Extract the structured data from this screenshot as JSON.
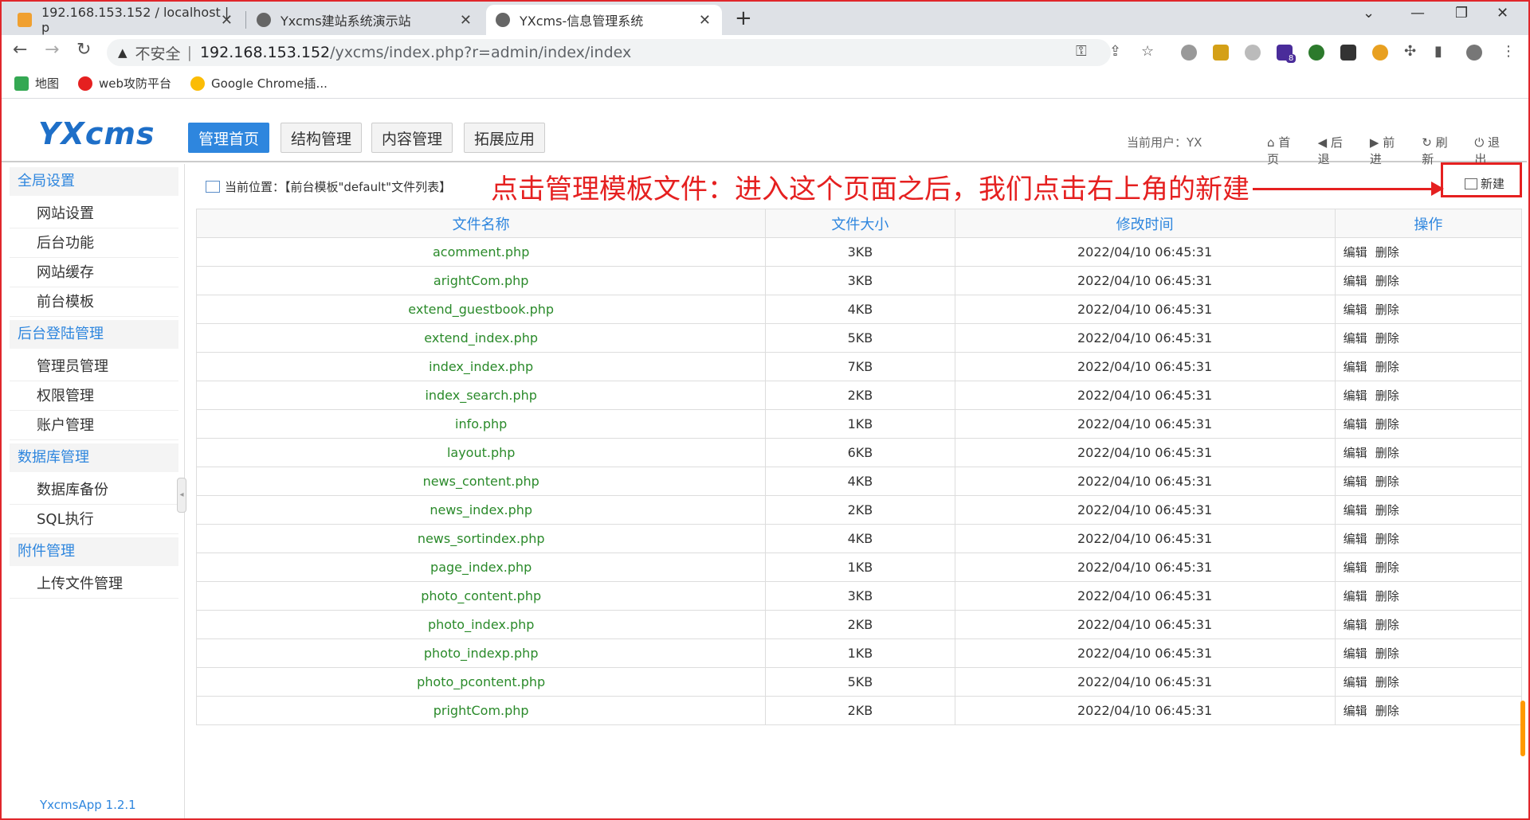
{
  "browser": {
    "tabs": [
      {
        "title": "192.168.153.152 / localhost | p",
        "active": false
      },
      {
        "title": "Yxcms建站系统演示站",
        "active": false
      },
      {
        "title": "YXcms-信息管理系统",
        "active": true
      }
    ],
    "address": {
      "security": "不安全",
      "host": "192.168.153.152",
      "path": "/yxcms/index.php?r=admin/index/index"
    },
    "extension_badge": "8",
    "bookmarks": [
      "地图",
      "web攻防平台",
      "Google Chrome插..."
    ]
  },
  "app": {
    "logo": "YXcms",
    "nav": [
      "管理首页",
      "结构管理",
      "内容管理",
      "拓展应用"
    ],
    "current_user": "当前用户：YX",
    "header_links": [
      "首页",
      "后退",
      "前进",
      "刷新",
      "退出"
    ],
    "sidebar": [
      {
        "group": "全局设置",
        "items": [
          "网站设置",
          "后台功能",
          "网站缓存",
          "前台模板"
        ]
      },
      {
        "group": "后台登陆管理",
        "items": [
          "管理员管理",
          "权限管理",
          "账户管理"
        ]
      },
      {
        "group": "数据库管理",
        "items": [
          "数据库备份",
          "SQL执行"
        ]
      },
      {
        "group": "附件管理",
        "items": [
          "上传文件管理"
        ]
      }
    ],
    "version": "YxcmsApp 1.2.1",
    "breadcrumb": "当前位置：【前台模板\"default\"文件列表】",
    "new_button": "新建",
    "annotation": "点击管理模板文件：进入这个页面之后，我们点击右上角的新建",
    "table": {
      "headers": [
        "文件名称",
        "文件大小",
        "修改时间",
        "操作"
      ],
      "ops": [
        "编辑",
        "删除"
      ],
      "rows": [
        [
          "acomment.php",
          "3KB",
          "2022/04/10 06:45:31"
        ],
        [
          "arightCom.php",
          "3KB",
          "2022/04/10 06:45:31"
        ],
        [
          "extend_guestbook.php",
          "4KB",
          "2022/04/10 06:45:31"
        ],
        [
          "extend_index.php",
          "5KB",
          "2022/04/10 06:45:31"
        ],
        [
          "index_index.php",
          "7KB",
          "2022/04/10 06:45:31"
        ],
        [
          "index_search.php",
          "2KB",
          "2022/04/10 06:45:31"
        ],
        [
          "info.php",
          "1KB",
          "2022/04/10 06:45:31"
        ],
        [
          "layout.php",
          "6KB",
          "2022/04/10 06:45:31"
        ],
        [
          "news_content.php",
          "4KB",
          "2022/04/10 06:45:31"
        ],
        [
          "news_index.php",
          "2KB",
          "2022/04/10 06:45:31"
        ],
        [
          "news_sortindex.php",
          "4KB",
          "2022/04/10 06:45:31"
        ],
        [
          "page_index.php",
          "1KB",
          "2022/04/10 06:45:31"
        ],
        [
          "photo_content.php",
          "3KB",
          "2022/04/10 06:45:31"
        ],
        [
          "photo_index.php",
          "2KB",
          "2022/04/10 06:45:31"
        ],
        [
          "photo_indexp.php",
          "1KB",
          "2022/04/10 06:45:31"
        ],
        [
          "photo_pcontent.php",
          "5KB",
          "2022/04/10 06:45:31"
        ],
        [
          "prightCom.php",
          "2KB",
          "2022/04/10 06:45:31"
        ]
      ]
    }
  }
}
